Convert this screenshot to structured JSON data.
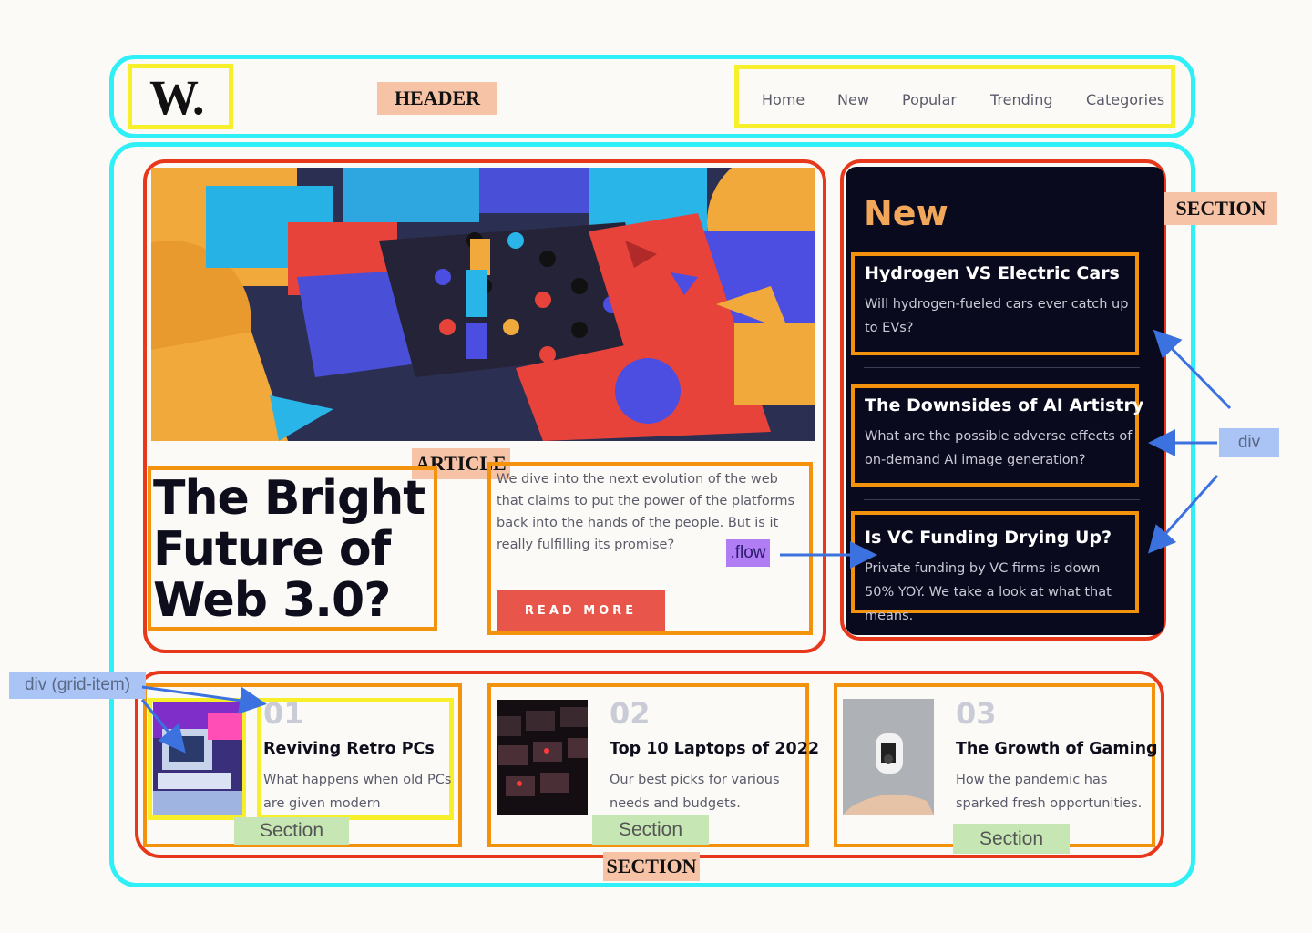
{
  "header": {
    "logo": "W.",
    "tag": "HEADER",
    "nav": [
      "Home",
      "New",
      "Popular",
      "Trending",
      "Categories"
    ]
  },
  "article": {
    "tag": "ARTICLE",
    "title_lines": [
      "The Bright",
      "Future of",
      "Web 3.0?"
    ],
    "description": "We dive into the next evolution of the web that claims to put the power of the platforms back into the hands of the people. But is it really fulfilling its promise?",
    "flow_tag": ".flow",
    "button": "READ MORE"
  },
  "aside": {
    "tag": "SECTION",
    "heading": "New",
    "div_tag": "div",
    "items": [
      {
        "title": "Hydrogen VS Electric Cars",
        "desc": "Will hydrogen-fueled cars ever catch up to EVs?"
      },
      {
        "title": "The Downsides of AI Artistry",
        "desc": "What are the possible adverse effects of on-demand AI image generation?"
      },
      {
        "title": "Is VC Funding Drying Up?",
        "desc": "Private funding by VC firms is down 50% YOY. We take a look at what that means."
      }
    ]
  },
  "bottom": {
    "tag": "SECTION",
    "grid_item_tag": "div (grid-item)",
    "section_tag": "Section",
    "items": [
      {
        "num": "01",
        "title": "Reviving Retro PCs",
        "desc": "What happens when old PCs are given modern upgrades?"
      },
      {
        "num": "02",
        "title": "Top 10 Laptops of 2022",
        "desc": "Our best picks for various needs and budgets."
      },
      {
        "num": "03",
        "title": "The Growth of Gaming",
        "desc": "How the pandemic has sparked fresh opportunities."
      }
    ]
  },
  "colors": {
    "header_outline": "#2ef0f6",
    "component_outline": "#f7ef2a",
    "section_outline": "#e8381c",
    "block_outline": "#f3920c",
    "accent_button": "#e8554a",
    "new_heading": "#f2a65a",
    "panel_bg": "#0a0a1e"
  }
}
